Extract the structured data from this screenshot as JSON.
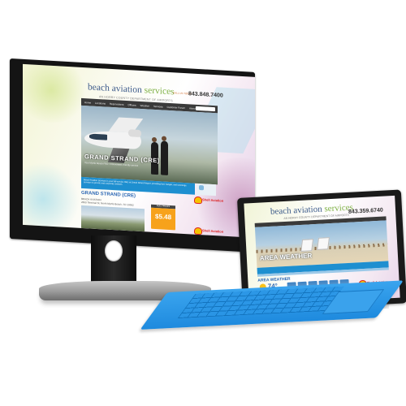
{
  "monitor_site": {
    "logo_main": "beach aviation",
    "logo_accent": "services",
    "tagline": "AN HORRY COUNTY DEPARTMENT OF AIRPORTS",
    "call_label": "CALL US TODAY",
    "phone": "843.848.7400",
    "nav": [
      "Home",
      "Locations",
      "Reservations",
      "Officers",
      "Weather",
      "Services",
      "Customer Forum",
      "About Us"
    ],
    "hero_title": "GRAND STRAND (CRE)",
    "hero_sub": "Your Myrtle Beach FBO • Convenient, friendly service",
    "strip_text": "Beach Aviation Services is your full-service FBO at Grand Strand Airport, providing fuel, hangar, and concierge services to private and corporate aviators.",
    "section_title": "GRAND STRAND (CRE)",
    "section_line1": "BEACH AVIATION",
    "section_line2": "2800 Terminal St, North Myrtle Beach, SC 29582",
    "fuel_label": "FUEL PRICES",
    "fuel_price": "$5.48",
    "brand1": "Shell Aviation",
    "brand2": "Shell Aviation"
  },
  "tablet_site": {
    "logo_main": "beach aviation",
    "logo_accent": "services",
    "tagline": "AN HORRY COUNTY DEPARTMENT OF AIRPORTS",
    "phone": "843.359.6740",
    "hero_title": "AREA WEATHER",
    "section_title": "AREA WEATHER",
    "temperature": "74°",
    "brand": "Shell Aviation"
  }
}
